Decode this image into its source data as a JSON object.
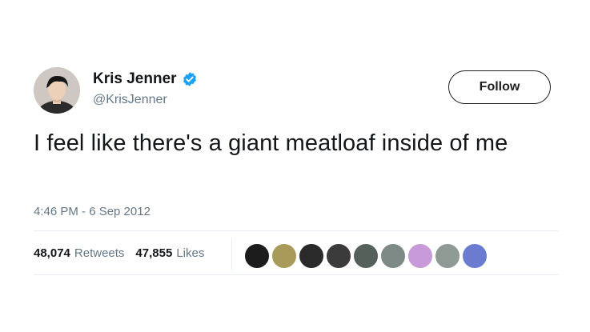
{
  "tweet": {
    "author": {
      "display_name": "Kris Jenner",
      "handle": "@KrisJenner",
      "verified": true
    },
    "follow_label": "Follow",
    "text": "I feel like there's a giant meatloaf inside of me",
    "timestamp": "4:46 PM - 6 Sep 2012",
    "stats": {
      "retweets_count": "48,074",
      "retweets_label": "Retweets",
      "likes_count": "47,855",
      "likes_label": "Likes"
    },
    "likers": [
      {
        "name": "liker-avatar-1",
        "color": "#1c1c1c"
      },
      {
        "name": "liker-avatar-2",
        "color": "#a89b5a"
      },
      {
        "name": "liker-avatar-3",
        "color": "#2a2a2a"
      },
      {
        "name": "liker-avatar-4",
        "color": "#3b3b3b"
      },
      {
        "name": "liker-avatar-5",
        "color": "#56605a"
      },
      {
        "name": "liker-avatar-6",
        "color": "#7d8a86"
      },
      {
        "name": "liker-avatar-7",
        "color": "#c99ad9"
      },
      {
        "name": "liker-avatar-8",
        "color": "#8f9a95"
      },
      {
        "name": "liker-avatar-9",
        "color": "#6a7bd0"
      }
    ]
  },
  "colors": {
    "text": "#14171a",
    "secondary": "#657786",
    "verified": "#1da1f2",
    "divider": "#e6ecf0"
  }
}
